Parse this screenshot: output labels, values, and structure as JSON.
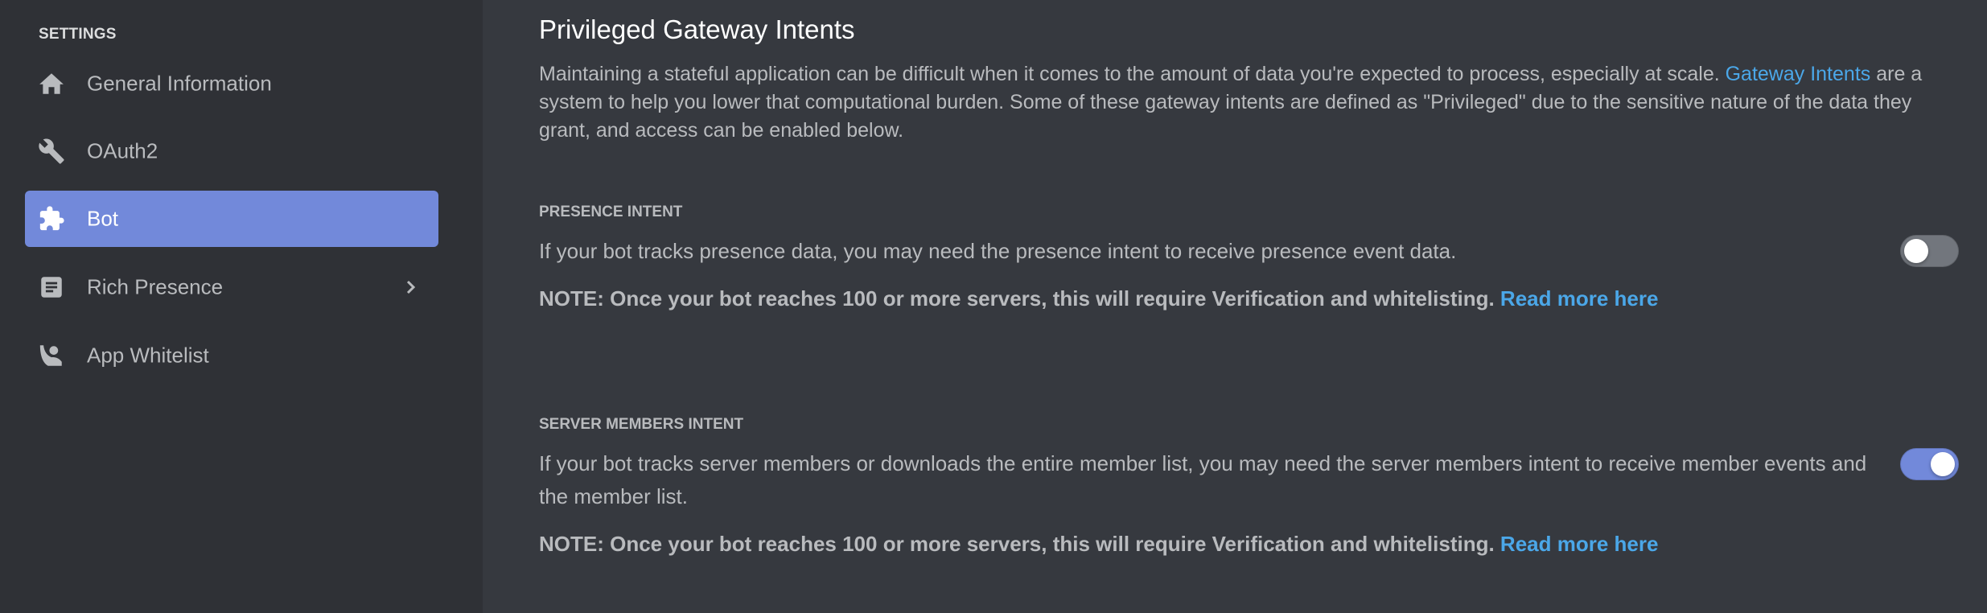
{
  "sidebar": {
    "header": "SETTINGS",
    "items": [
      {
        "label": "General Information",
        "icon": "home-icon",
        "active": false
      },
      {
        "label": "OAuth2",
        "icon": "wrench-icon",
        "active": false
      },
      {
        "label": "Bot",
        "icon": "puzzle-icon",
        "active": true
      },
      {
        "label": "Rich Presence",
        "icon": "document-icon",
        "active": false,
        "has_submenu": true
      },
      {
        "label": "App Whitelist",
        "icon": "user-wave-icon",
        "active": false
      }
    ]
  },
  "main": {
    "title": "Privileged Gateway Intents",
    "intro": {
      "text_before": "Maintaining a stateful application can be difficult when it comes to the amount of data you're expected to process, especially at scale. ",
      "link": "Gateway Intents",
      "text_after": " are a system to help you lower that computational burden. Some of these gateway intents are defined as \"Privileged\" due to the sensitive nature of the data they grant, and access can be enabled below."
    },
    "sections": [
      {
        "title": "PRESENCE INTENT",
        "description": "If your bot tracks presence data, you may need the presence intent to receive presence event data.",
        "note": "NOTE: Once your bot reaches 100 or more servers, this will require Verification and whitelisting. ",
        "note_link": "Read more here",
        "enabled": false
      },
      {
        "title": "SERVER MEMBERS INTENT",
        "description": "If your bot tracks server members or downloads the entire member list, you may need the server members intent to receive member events and the member list.",
        "note": "NOTE: Once your bot reaches 100 or more servers, this will require Verification and whitelisting. ",
        "note_link": "Read more here",
        "enabled": true
      }
    ]
  },
  "colors": {
    "sidebar_bg": "#2f3136",
    "main_bg": "#36393f",
    "accent": "#7289da",
    "link": "#4ba7e8",
    "text_muted": "#b9bbbe",
    "toggle_off": "#72767d"
  }
}
